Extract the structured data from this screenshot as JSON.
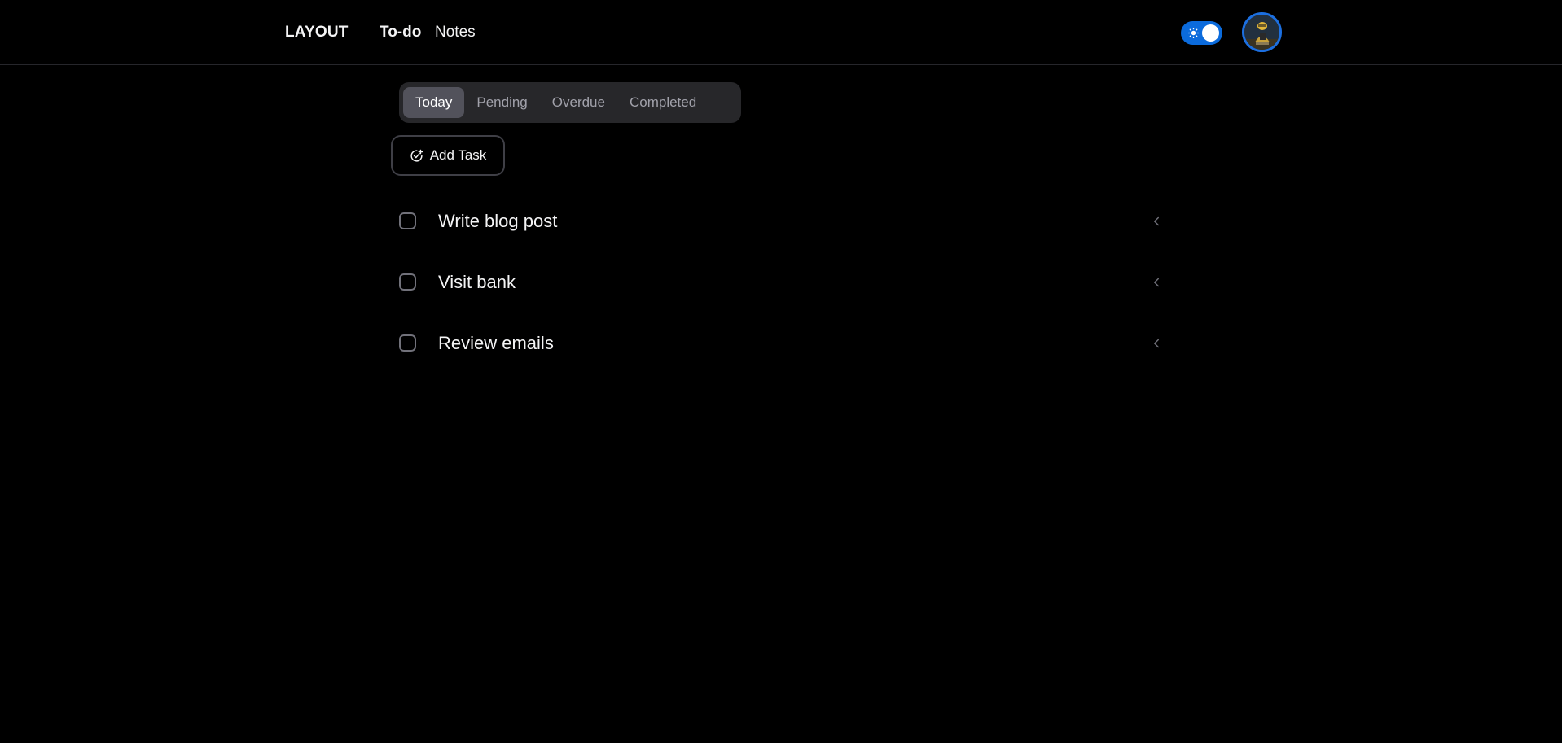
{
  "header": {
    "brand": "LAYOUT",
    "nav": [
      {
        "label": "To-do",
        "active": true
      },
      {
        "label": "Notes",
        "active": false
      }
    ],
    "theme_toggle_icon": "sun-icon",
    "avatar_icon": "user-avatar-icon"
  },
  "tabs": [
    {
      "label": "Today",
      "active": true
    },
    {
      "label": "Pending",
      "active": false
    },
    {
      "label": "Overdue",
      "active": false
    },
    {
      "label": "Completed",
      "active": false
    }
  ],
  "add_task": {
    "label": "Add Task",
    "icon": "circle-check-plus-icon"
  },
  "tasks": [
    {
      "title": "Write blog post",
      "checked": false
    },
    {
      "title": "Visit bank",
      "checked": false
    },
    {
      "title": "Review emails",
      "checked": false
    }
  ],
  "colors": {
    "background": "#000000",
    "accent": "#0b6bdc",
    "tab_bar": "#27272a",
    "tab_active": "#52525b"
  }
}
